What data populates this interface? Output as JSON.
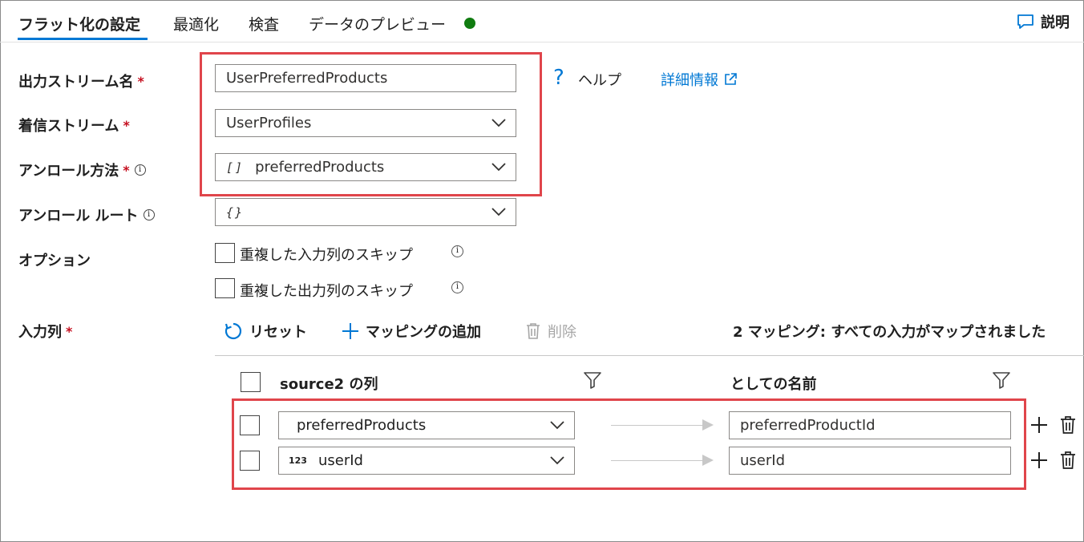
{
  "tabs": [
    {
      "label": "フラット化の設定",
      "active": true
    },
    {
      "label": "最適化",
      "active": false
    },
    {
      "label": "検査",
      "active": false
    },
    {
      "label": "データのプレビュー",
      "active": false
    }
  ],
  "explain_label": "説明",
  "form": {
    "output_stream_label": "出力ストリーム名",
    "output_stream_value": "UserPreferredProducts",
    "incoming_stream_label": "着信ストリーム",
    "incoming_stream_value": "UserProfiles",
    "unroll_by_label": "アンロール方法",
    "unroll_by_type_glyph": "[]",
    "unroll_by_value": "preferredProducts",
    "unroll_root_label": "アンロール ルート",
    "unroll_root_type_glyph": "{}",
    "options_label": "オプション",
    "option_skip_input": "重複した入力列のスキップ",
    "option_skip_output": "重複した出力列のスキップ",
    "input_columns_label": "入力列",
    "required_mark": "*"
  },
  "help": {
    "help_label": "ヘルプ",
    "more_info_link": "詳細情報"
  },
  "toolbar": {
    "reset": "リセット",
    "add_mapping": "マッピングの追加",
    "delete": "削除",
    "summary": "2 マッピング: すべての入力がマップされました"
  },
  "mapping_table": {
    "source_header": "source2 の列",
    "target_header": "としての名前",
    "rows": [
      {
        "type_glyph": "",
        "source": "preferredProducts",
        "target": "preferredProductId"
      },
      {
        "type_glyph": "123",
        "source": "userId",
        "target": "userId"
      }
    ]
  },
  "colors": {
    "accent": "#0078d4",
    "highlight_border": "#e0454b",
    "status_ok": "#107c10",
    "required": "#c50f1f"
  }
}
